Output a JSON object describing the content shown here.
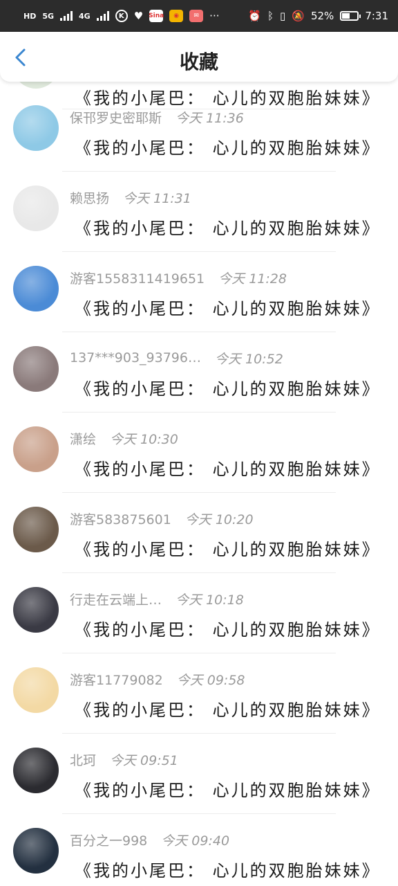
{
  "status_bar": {
    "net_left": "HD",
    "net_5g": "5G",
    "net_4g": "4G",
    "app_k": "K",
    "app_sina": "Sina",
    "battery_pct": "52%",
    "battery_level": 0.52,
    "time": "7:31",
    "more": "···"
  },
  "header": {
    "title": "收藏",
    "back_icon": "chevron-left-icon"
  },
  "book_title": "《我的小尾巴： 心儿的双胞胎妹妹》",
  "items": [
    {
      "user": "",
      "time": "",
      "avatar_color": "#dfe9dc"
    },
    {
      "user": "保邗罗史密耶斯",
      "time": "今天 11:36",
      "avatar_color": "#8ec9e6"
    },
    {
      "user": "赖思扬",
      "time": "今天 11:31",
      "avatar_color": "#e8e8e8"
    },
    {
      "user": "游客1558311419651",
      "time": "今天 11:28",
      "avatar_color": "#4b8bd6"
    },
    {
      "user": "137***903_93796…",
      "time": "今天 10:52",
      "avatar_color": "#8a7a7a"
    },
    {
      "user": "潇绘",
      "time": "今天 10:30",
      "avatar_color": "#c9a08a"
    },
    {
      "user": "游客583875601",
      "time": "今天 10:20",
      "avatar_color": "#6b5a4a"
    },
    {
      "user": "行走在云端上…",
      "time": "今天 10:18",
      "avatar_color": "#3a3a44"
    },
    {
      "user": "游客11779082",
      "time": "今天 09:58",
      "avatar_color": "#f3d9a4"
    },
    {
      "user": "北珂",
      "time": "今天 09:51",
      "avatar_color": "#2b2b30"
    },
    {
      "user": "百分之一998",
      "time": "今天 09:40",
      "avatar_color": "#233040"
    }
  ]
}
